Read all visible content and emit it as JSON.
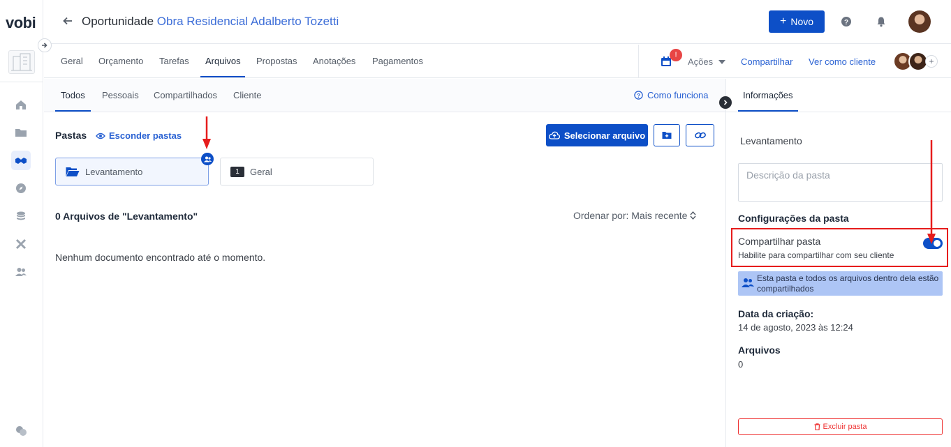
{
  "sidebar": {
    "logo": "vobi"
  },
  "header": {
    "title_prefix": "Oportunidade",
    "title_link": "Obra Residencial Adalberto Tozetti",
    "new_button": "Novo"
  },
  "main_tabs": [
    "Geral",
    "Orçamento",
    "Tarefas",
    "Arquivos",
    "Propostas",
    "Anotações",
    "Pagamentos"
  ],
  "main_tabs_active": "Arquivos",
  "actions": {
    "notification_count": "!",
    "acoes": "Ações",
    "share": "Compartilhar",
    "view_as_client": "Ver como cliente",
    "add_member": "+"
  },
  "sub_tabs": [
    "Todos",
    "Pessoais",
    "Compartilhados",
    "Cliente"
  ],
  "sub_tabs_active": "Todos",
  "how_it_works": "Como funciona",
  "content": {
    "pastas_label": "Pastas",
    "hide_folders": "Esconder pastas",
    "select_file": "Selecionar arquivo",
    "folders": [
      {
        "name": "Levantamento",
        "selected": true,
        "shared": true
      },
      {
        "name": "Geral",
        "count": "1",
        "selected": false
      }
    ],
    "files_title": "0 Arquivos de \"Levantamento\"",
    "sort_label": "Ordenar por: Mais recente",
    "empty_message": "Nenhum documento encontrado até o momento."
  },
  "panel": {
    "tab": "Informações",
    "folder_name": "Levantamento",
    "description_placeholder": "Descrição da pasta",
    "config_title": "Configurações  da pasta",
    "share_label": "Compartilhar pasta",
    "share_hint": "Habilite para compartilhar com seu cliente",
    "share_enabled": true,
    "shared_notice": "Esta pasta e todos os arquivos dentro dela estão compartilhados",
    "created_label": "Data da criação:",
    "created_value": "14 de agosto, 2023 às 12:24",
    "files_label": "Arquivos",
    "files_value": "0",
    "delete_button": "Excluir pasta"
  },
  "colors": {
    "primary": "#0d4fc7",
    "link": "#2a62d3",
    "annotation": "#e61c1c",
    "danger": "#e33333"
  }
}
